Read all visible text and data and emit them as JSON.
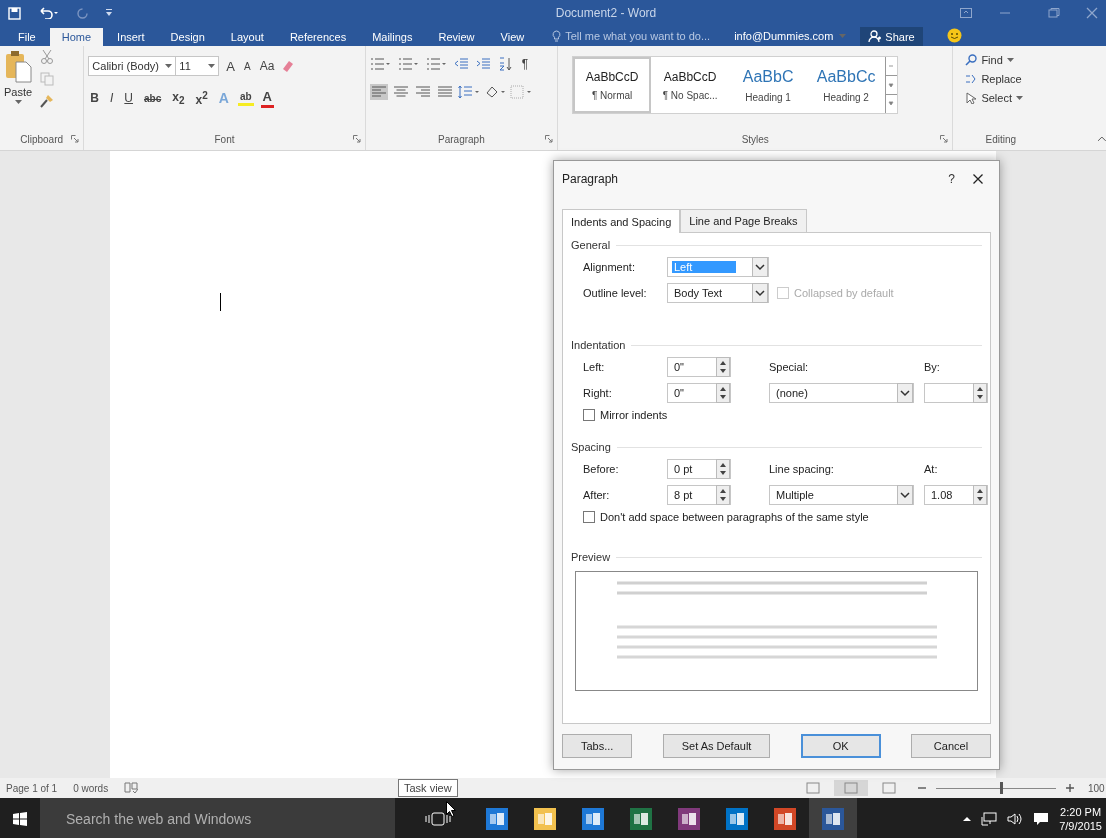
{
  "window": {
    "title": "Document2 - Word"
  },
  "ribbon_tabs": [
    {
      "label": "File",
      "selected": false
    },
    {
      "label": "Home",
      "selected": true
    },
    {
      "label": "Insert",
      "selected": false
    },
    {
      "label": "Design",
      "selected": false
    },
    {
      "label": "Layout",
      "selected": false
    },
    {
      "label": "References",
      "selected": false
    },
    {
      "label": "Mailings",
      "selected": false
    },
    {
      "label": "Review",
      "selected": false
    },
    {
      "label": "View",
      "selected": false
    }
  ],
  "tell_me": {
    "placeholder": "Tell me what you want to do..."
  },
  "account": "info@Dummies.com",
  "share": "Share",
  "clipboard": {
    "label": "Clipboard",
    "paste": "Paste"
  },
  "font": {
    "label": "Font",
    "font_name": "Calibri (Body)",
    "font_size": "11",
    "grow": "A",
    "shrink": "A",
    "change_case": "Aa",
    "bold": "B",
    "italic": "I",
    "underline": "U",
    "strikethrough": "abc",
    "subscript": "x$_{2}$",
    "superscript": "x$^{2}$",
    "effects": "A",
    "highlight": "ab",
    "font_color": "A"
  },
  "paragraph": {
    "label": "Paragraph",
    "show_marks": "¶",
    "alignments": [
      {
        "selected": true
      },
      {
        "selected": false
      },
      {
        "selected": false
      },
      {
        "selected": false
      }
    ]
  },
  "styles": {
    "label": "Styles",
    "items": [
      {
        "preview": "AaBbCcD",
        "name": "¶ Normal",
        "kind": "body",
        "selected": true
      },
      {
        "preview": "AaBbCcD",
        "name": "¶ No Spac...",
        "kind": "body",
        "selected": false
      },
      {
        "preview": "AaBbC",
        "name": "Heading 1",
        "kind": "heading",
        "selected": false
      },
      {
        "preview": "AaBbCc",
        "name": "Heading 2",
        "kind": "heading",
        "selected": false
      }
    ]
  },
  "editing": {
    "label": "Editing",
    "find": "Find",
    "replace": "Replace",
    "select": "Select"
  },
  "dialog": {
    "title": "Paragraph",
    "help": "?",
    "tabs": [
      {
        "label": "Indents and Spacing",
        "selected": true
      },
      {
        "label": "Line and Page Breaks",
        "selected": false
      }
    ],
    "general": {
      "heading": "General",
      "alignment": {
        "label": "Alignment:",
        "value": "Left",
        "highlighted": true
      },
      "outline_level": {
        "label": "Outline level:",
        "value": "Body Text"
      },
      "collapsed": {
        "label": "Collapsed by default",
        "checked": false,
        "disabled": true
      }
    },
    "indentation": {
      "heading": "Indentation",
      "left": {
        "label": "Left:",
        "value": "0\""
      },
      "right": {
        "label": "Right:",
        "value": "0\""
      },
      "special": {
        "label": "Special:",
        "value": "(none)"
      },
      "by": {
        "label": "By:"
      },
      "mirror": {
        "label": "Mirror indents",
        "checked": false,
        "disabled": false
      }
    },
    "spacing": {
      "heading": "Spacing",
      "before": {
        "label": "Before:",
        "value": "0 pt"
      },
      "after": {
        "label": "After:",
        "value": "8 pt"
      },
      "line_spacing": {
        "label": "Line spacing:",
        "value": "Multiple"
      },
      "at": {
        "label": "At:",
        "value": "1.08"
      },
      "dont_add": {
        "label": "Don't add space between paragraphs of the same style",
        "checked": false,
        "disabled": false
      }
    },
    "preview": {
      "heading": "Preview"
    },
    "buttons": [
      {
        "label": "Tabs...",
        "default": false
      },
      {
        "label": "Set As Default",
        "default": false
      },
      {
        "label": "OK",
        "default": true
      },
      {
        "label": "Cancel",
        "default": false
      }
    ]
  },
  "status_bar": {
    "page": "Page 1 of 1",
    "words": "0 words",
    "views": [
      {
        "selected": false
      },
      {
        "selected": true
      },
      {
        "selected": false
      }
    ],
    "zoom": {
      "level": 0.55,
      "reading": "100"
    }
  },
  "tooltip": "Task view",
  "taskbar": {
    "search": {
      "placeholder": "Search the web and Windows"
    },
    "apps": [
      {
        "color": "#1e78d6",
        "selected": false
      },
      {
        "color": "#f2c14e",
        "selected": false
      },
      {
        "color": "#1e78d6",
        "selected": false
      },
      {
        "color": "#1f7244",
        "selected": false
      },
      {
        "color": "#80397b",
        "selected": false
      },
      {
        "color": "#0072c6",
        "selected": false
      },
      {
        "color": "#d24726",
        "selected": false
      },
      {
        "color": "#2b579a",
        "selected": true
      }
    ],
    "time": "2:20 PM",
    "date": "7/9/2015"
  }
}
